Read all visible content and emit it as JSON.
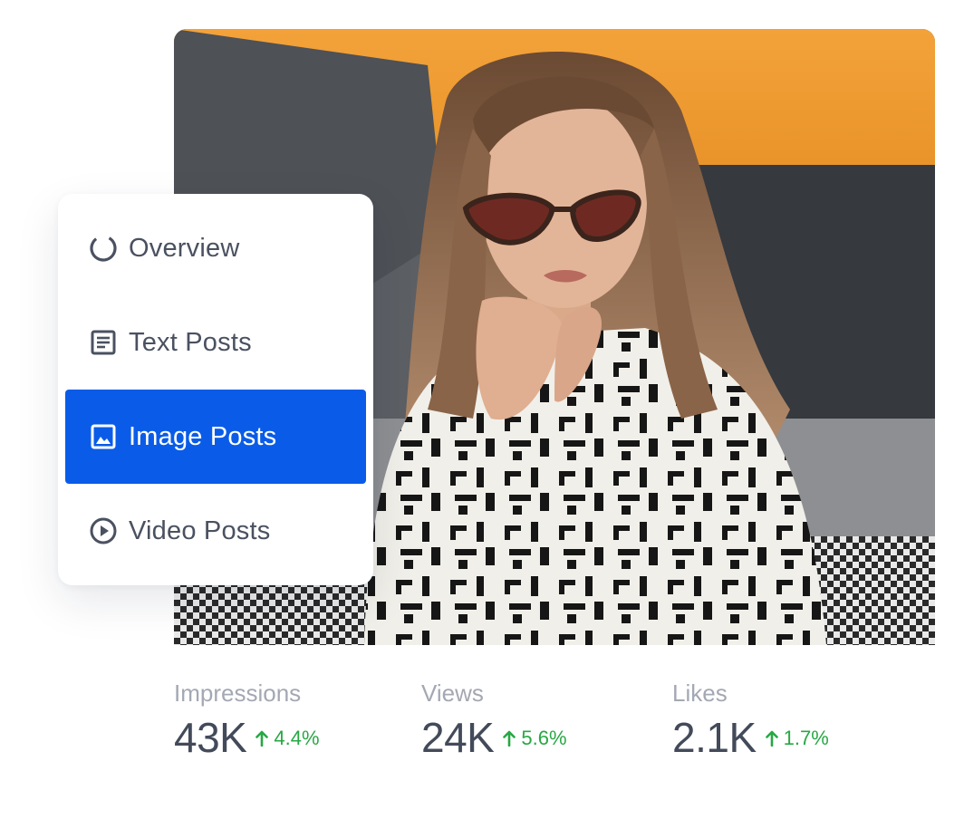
{
  "menu": {
    "items": [
      {
        "label": "Overview",
        "icon": "overview-ring-icon",
        "active": false
      },
      {
        "label": "Text Posts",
        "icon": "document-icon",
        "active": false
      },
      {
        "label": "Image Posts",
        "icon": "image-icon",
        "active": true
      },
      {
        "label": "Video Posts",
        "icon": "play-circle-icon",
        "active": false
      }
    ]
  },
  "stats": [
    {
      "label": "Impressions",
      "value": "43K",
      "change": "4.4%",
      "trend": "up"
    },
    {
      "label": "Views",
      "value": "24K",
      "change": "5.6%",
      "trend": "up"
    },
    {
      "label": "Likes",
      "value": "2.1K",
      "change": "1.7%",
      "trend": "up"
    }
  ],
  "colors": {
    "accent": "#0a5ce8",
    "positive": "#27a844",
    "text": "#434a59",
    "muted": "#a3a8b3"
  }
}
